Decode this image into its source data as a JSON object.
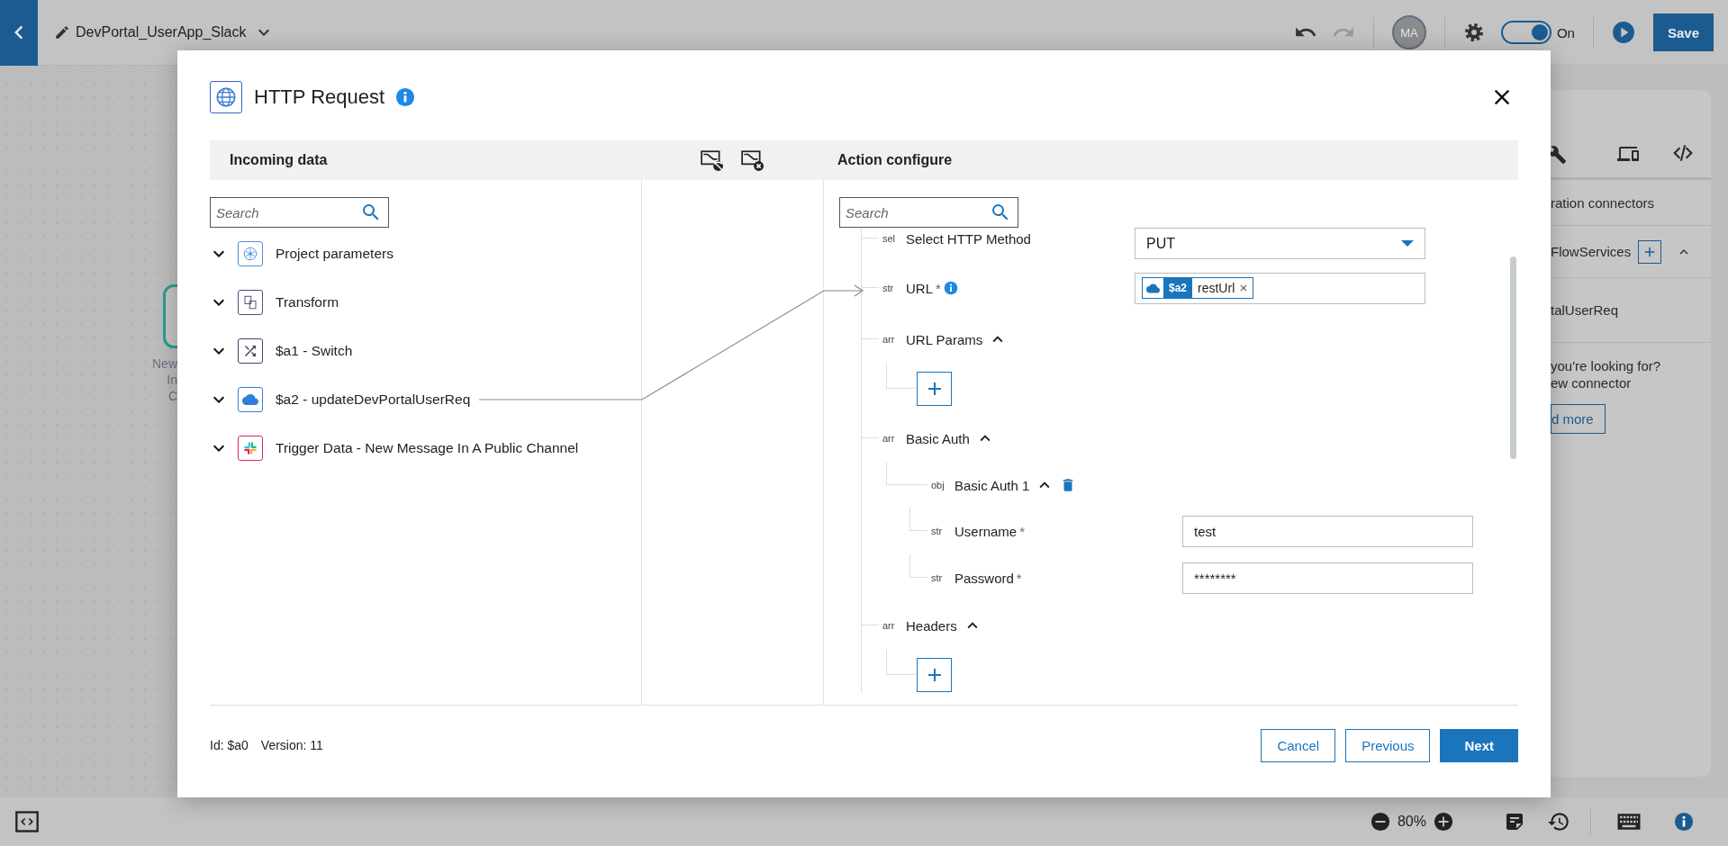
{
  "top_bar": {
    "title": "DevPortal_UserApp_Slack",
    "avatar": "MA",
    "toggle": {
      "on": true,
      "label": "On"
    },
    "save_button": "Save"
  },
  "canvas": {
    "node_label": [
      "New",
      "In",
      "C"
    ]
  },
  "right_panel": {
    "section": "ration connectors",
    "group": {
      "label": "FlowServices",
      "expanded": true
    },
    "item": "talUserReq",
    "help": [
      "you're looking for?",
      "ew connector"
    ],
    "button": "d more"
  },
  "modal": {
    "title": "HTTP Request",
    "incoming": {
      "heading": "Incoming data",
      "search_placeholder": "Search",
      "items": [
        {
          "label": "Project parameters",
          "kind": "params",
          "expanded": false
        },
        {
          "label": "Transform",
          "kind": "transform",
          "expanded": false
        },
        {
          "label": "$a1 - Switch",
          "kind": "switch",
          "expanded": false
        },
        {
          "label": "$a2 - updateDevPortalUserReq",
          "kind": "cloud",
          "expanded": false
        },
        {
          "label": "Trigger Data - New Message In A Public Channel",
          "kind": "slack",
          "expanded": false
        }
      ]
    },
    "action": {
      "heading": "Action configure",
      "search_placeholder": "Search",
      "fields": [
        {
          "kind": "select",
          "type": "sel",
          "label": "Select HTTP Method",
          "value": "PUT"
        },
        {
          "kind": "mapped",
          "type": "str",
          "label": "URL",
          "required_mark": "*",
          "info": true,
          "chip": {
            "source": "$a2",
            "field": "restUrl"
          }
        },
        {
          "kind": "array",
          "type": "arr",
          "label": "URL Params",
          "expanded": true
        },
        {
          "kind": "array",
          "type": "arr",
          "label": "Basic Auth",
          "expanded": true,
          "children": [
            {
              "kind": "object",
              "type": "obj",
              "label": "Basic Auth 1",
              "expanded": true,
              "children": [
                {
                  "kind": "input",
                  "type": "str",
                  "label": "Username",
                  "required_mark": "*",
                  "value": "test"
                },
                {
                  "kind": "input",
                  "type": "str",
                  "label": "Password",
                  "required_mark": "*",
                  "value": "********"
                }
              ]
            }
          ]
        },
        {
          "kind": "array",
          "type": "arr",
          "label": "Headers",
          "expanded": true
        }
      ]
    },
    "footer": {
      "id": "Id: $a0",
      "version": "Version: 11",
      "buttons": [
        {
          "label": "Cancel",
          "kind": "secondary"
        },
        {
          "label": "Previous",
          "kind": "secondary"
        },
        {
          "label": "Next",
          "kind": "primary"
        }
      ]
    }
  },
  "bottom_bar": {
    "zoom": "80%"
  }
}
